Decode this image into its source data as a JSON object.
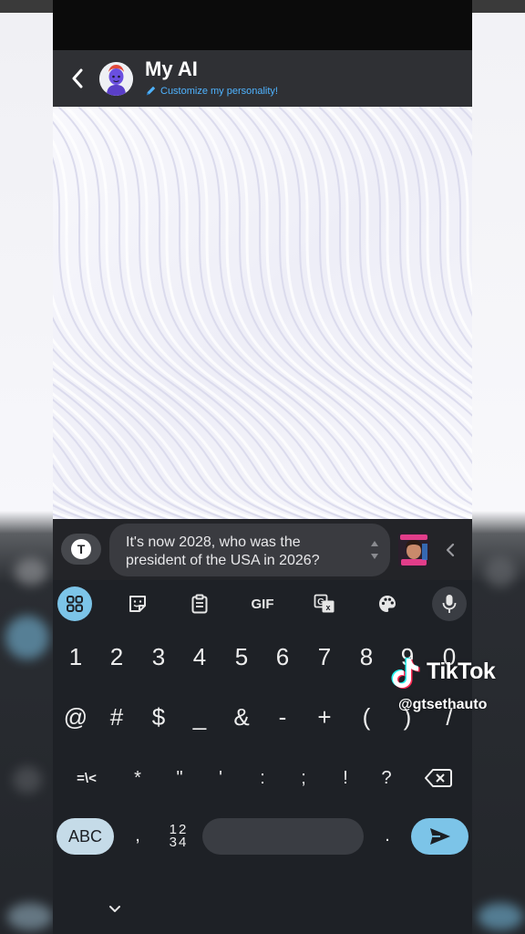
{
  "header": {
    "title": "My AI",
    "subtitle": "Customize my personality!"
  },
  "composer": {
    "message_text": "It's now 2028, who was the president of the USA in 2026?",
    "message_line1": "It's now 2028, who was the",
    "message_line2": "president of the USA in 2026?",
    "tools_button_label": "T"
  },
  "keyboard": {
    "toolbar": [
      "apps-grid",
      "sticker",
      "clipboard",
      "GIF",
      "translate",
      "palette",
      "mic"
    ],
    "gif_label": "GIF",
    "row1": [
      "1",
      "2",
      "3",
      "4",
      "5",
      "6",
      "7",
      "8",
      "9",
      "0"
    ],
    "row2": [
      "@",
      "#",
      "$",
      "_",
      "&",
      "-",
      "+",
      "(",
      ")",
      "/"
    ],
    "row3": [
      "=\\<",
      "*",
      "\"",
      "'",
      ":",
      ";",
      "!",
      "?"
    ],
    "abc_label": "ABC",
    "comma": ",",
    "period": ".",
    "numpad_top": "12",
    "numpad_bottom": "34"
  },
  "watermark": {
    "brand": "TikTok",
    "handle": "@gtsethauto"
  },
  "colors": {
    "accent_blue": "#7cc4e8",
    "link_blue": "#4fb3ff",
    "header_bg": "#2f3034",
    "keyboard_bg": "#1e2126"
  }
}
